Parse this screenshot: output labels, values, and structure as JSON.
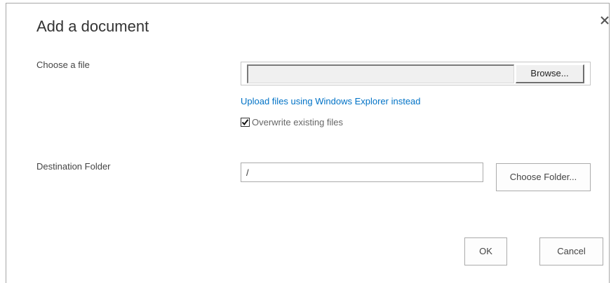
{
  "dialog": {
    "title": "Add a document",
    "close_icon": "close-icon"
  },
  "file": {
    "label": "Choose a file",
    "value": "",
    "browse_label": "Browse..."
  },
  "explorer_link": "Upload files using Windows Explorer instead",
  "overwrite": {
    "label": "Overwrite existing files",
    "checked": true
  },
  "destination": {
    "label": "Destination Folder",
    "value": "/",
    "choose_label": "Choose Folder..."
  },
  "footer": {
    "ok_label": "OK",
    "cancel_label": "Cancel"
  },
  "colors": {
    "link": "#0072c6",
    "border": "#ababab",
    "title_text": "#333333"
  }
}
